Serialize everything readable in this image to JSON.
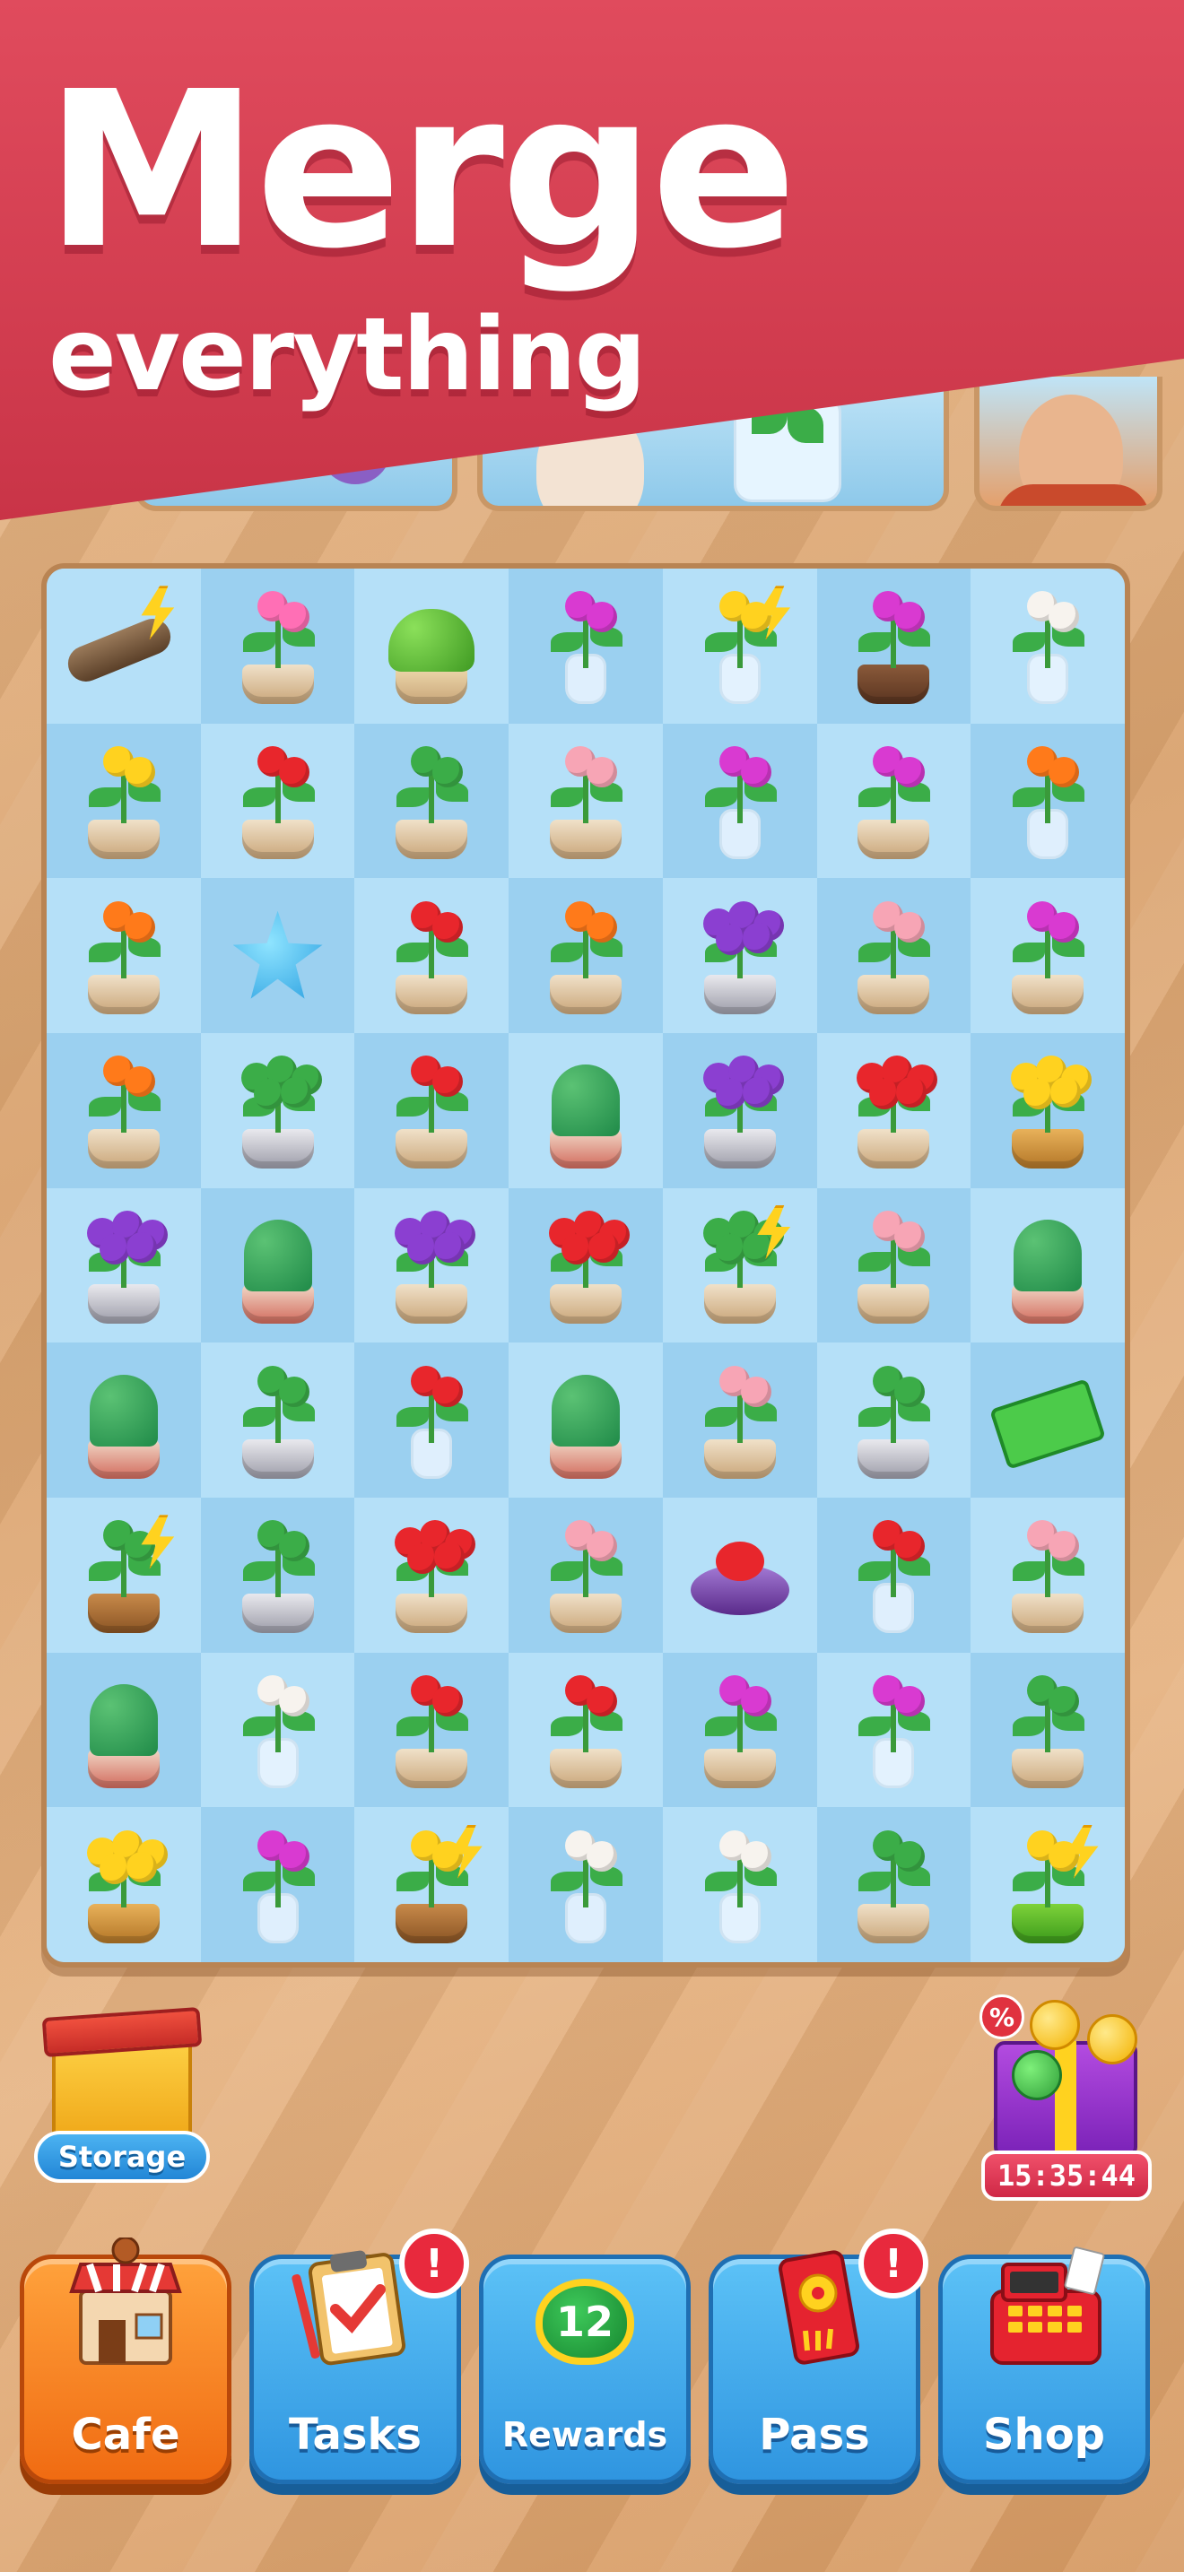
{
  "banner": {
    "title": "Merge",
    "subtitle": "everything"
  },
  "board": {
    "rows": [
      [
        {
          "kind": "driftwood",
          "bolt": true
        },
        {
          "kind": "bromeliad-pink"
        },
        {
          "kind": "bunny-cactus"
        },
        {
          "kind": "white-orchid-vase"
        },
        {
          "kind": "seedling-glass",
          "bolt": true
        },
        {
          "kind": "pink-orchid-pot"
        },
        {
          "kind": "white-lily-vase"
        }
      ],
      [
        {
          "kind": "yellow-stand"
        },
        {
          "kind": "bromeliad-red"
        },
        {
          "kind": "eucalyptus"
        },
        {
          "kind": "succulent-rosette"
        },
        {
          "kind": "magenta-lily"
        },
        {
          "kind": "pink-orchid"
        },
        {
          "kind": "orange-lily"
        }
      ],
      [
        {
          "kind": "bird-of-paradise"
        },
        {
          "kind": "blue-star"
        },
        {
          "kind": "red-amaryllis"
        },
        {
          "kind": "bird-of-paradise"
        },
        {
          "kind": "tulip-bag"
        },
        {
          "kind": "pink-peony"
        },
        {
          "kind": "orchid-globe"
        }
      ],
      [
        {
          "kind": "bird-of-paradise"
        },
        {
          "kind": "flower-hatbox"
        },
        {
          "kind": "red-amaryllis"
        },
        {
          "kind": "cactus-pot"
        },
        {
          "kind": "tulip-bag-grey"
        },
        {
          "kind": "red-tulip-bowl"
        },
        {
          "kind": "yellow-tulip-pineapple"
        }
      ],
      [
        {
          "kind": "white-tulip-bag"
        },
        {
          "kind": "cactus-pot"
        },
        {
          "kind": "purple-tulips"
        },
        {
          "kind": "red-rose-bouquet"
        },
        {
          "kind": "bouquet-bucket",
          "bolt": true
        },
        {
          "kind": "pink-peony"
        },
        {
          "kind": "cactus-pot"
        }
      ],
      [
        {
          "kind": "cactus-pot"
        },
        {
          "kind": "jade-plant"
        },
        {
          "kind": "red-rose-vase"
        },
        {
          "kind": "cactus-pot"
        },
        {
          "kind": "pink-peony"
        },
        {
          "kind": "aloe-pot"
        },
        {
          "kind": "cash-stack"
        }
      ],
      [
        {
          "kind": "succulent-crate",
          "bolt": true
        },
        {
          "kind": "aloe-pot"
        },
        {
          "kind": "red-tulip-bowl"
        },
        {
          "kind": "pink-peony"
        },
        {
          "kind": "rose-box"
        },
        {
          "kind": "red-rose-vase"
        },
        {
          "kind": "pink-peony"
        }
      ],
      [
        {
          "kind": "green-cactus"
        },
        {
          "kind": "white-lily-vase"
        },
        {
          "kind": "red-amaryllis"
        },
        {
          "kind": "red-amaryllis"
        },
        {
          "kind": "fern-orchid"
        },
        {
          "kind": "white-orchid-vase"
        },
        {
          "kind": "eucalyptus"
        }
      ],
      [
        {
          "kind": "yellow-tulip-pineapple"
        },
        {
          "kind": "orchid-tube"
        },
        {
          "kind": "seedling-crate",
          "bolt": true
        },
        {
          "kind": "calla-lily"
        },
        {
          "kind": "white-lily"
        },
        {
          "kind": "green-branch"
        },
        {
          "kind": "seedling-pot",
          "bolt": true
        }
      ]
    ]
  },
  "storage": {
    "label": "Storage",
    "icon": "storage-box-icon"
  },
  "offer": {
    "timer": "15:35:44",
    "tag": "%",
    "icon": "gift-offer-icon"
  },
  "nav": [
    {
      "label": "Cafe",
      "icon": "cafe-icon",
      "active": true
    },
    {
      "label": "Tasks",
      "icon": "clipboard-icon",
      "badge": "!"
    },
    {
      "label": "Rewards",
      "icon": "rewards-leaf-icon",
      "count": "12"
    },
    {
      "label": "Pass",
      "icon": "pass-ticket-icon",
      "badge": "!"
    },
    {
      "label": "Shop",
      "icon": "cash-register-icon"
    }
  ],
  "colors": {
    "banner": "#d63c50",
    "board": "#a7d8f4",
    "nav_blue": "#2f95e0",
    "nav_orange": "#f06b12",
    "badge": "#e8293d"
  }
}
